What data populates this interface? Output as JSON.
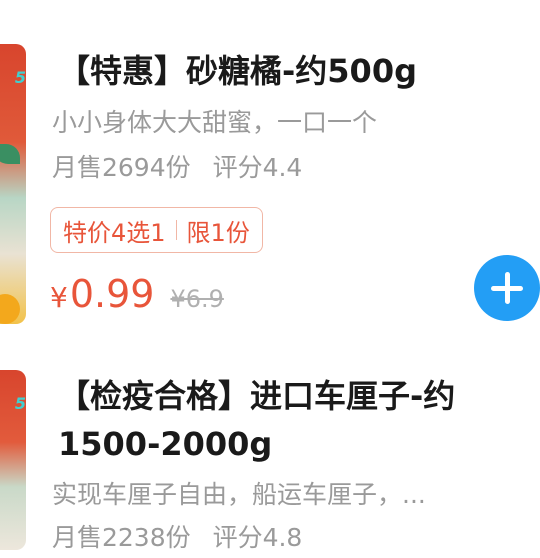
{
  "products": [
    {
      "image_alt": "砂糖橘",
      "image_tag": "5",
      "title": "【特惠】砂糖橘-约500g",
      "description": "小小身体大大甜蜜，一口一个",
      "monthly_sales": "月售2694份",
      "rating": "评分4.4",
      "promo_deal": "特价4选1",
      "promo_limit": "限1份",
      "currency": "¥",
      "price": "0.99",
      "original_price": "¥6.9",
      "add_icon": "plus-icon"
    },
    {
      "image_alt": "车厘子",
      "image_tag": "5",
      "title": "【检疫合格】进口车厘子-约1500-2000g",
      "description": "实现车厘子自由，船运车厘子，...",
      "monthly_sales": "月售2238份",
      "rating": "评分4.8"
    }
  ],
  "colors": {
    "accent": "#e8553a",
    "add_button": "#239ef5",
    "muted_text": "#9a9a9a",
    "title_text": "#1a1a1a"
  }
}
